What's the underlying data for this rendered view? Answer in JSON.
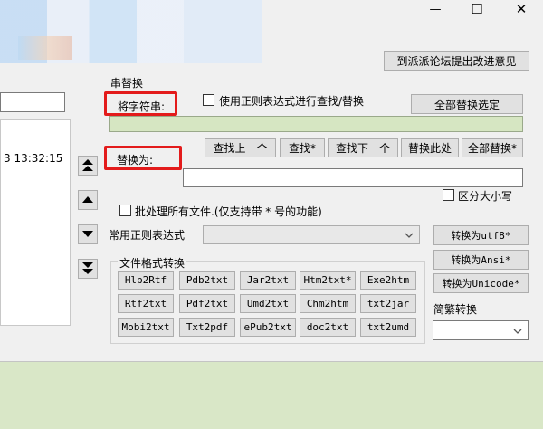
{
  "window": {
    "minimize_label": "—",
    "maximize_label": "☐",
    "close_label": "✕"
  },
  "forum_button": "到派派论坛提出改进意见",
  "left_panel": {
    "timestamp": "3 13:32:15"
  },
  "replace": {
    "section_title": "串替换",
    "find_label": "将字符串:",
    "use_regex_label": "使用正则表达式进行查找/替换",
    "replace_all_selected": "全部替换选定",
    "find_prev": "查找上一个",
    "find_star": "查找*",
    "find_next": "查找下一个",
    "replace_here": "替换此处",
    "replace_all": "全部替换*",
    "replace_label": "替换为:",
    "case_label": "区分大小写",
    "batch_label": "批处理所有文件.(仅支持带 * 号的功能)",
    "common_regex_label": "常用正则表达式"
  },
  "conversion": {
    "section_title": "文件格式转换",
    "buttons": [
      [
        "Hlp2Rtf",
        "Pdb2txt",
        "Jar2txt",
        "Htm2txt*",
        "Exe2htm"
      ],
      [
        "Rtf2txt",
        "Pdf2txt",
        "Umd2txt",
        "Chm2htm",
        "txt2jar"
      ],
      [
        "Mobi2txt",
        "Txt2pdf",
        "ePub2txt",
        "doc2txt",
        "txt2umd"
      ]
    ]
  },
  "encoding": {
    "to_utf8": "转换为utf8*",
    "to_ansi": "转换为Ansi*",
    "to_unicode": "转换为Unicode*"
  },
  "simp_trad_label": "简繁转换",
  "colors": {
    "green_field": "#d6e6c2",
    "bottom_panel": "#d9e7c7",
    "highlight": "#e31b1b"
  }
}
